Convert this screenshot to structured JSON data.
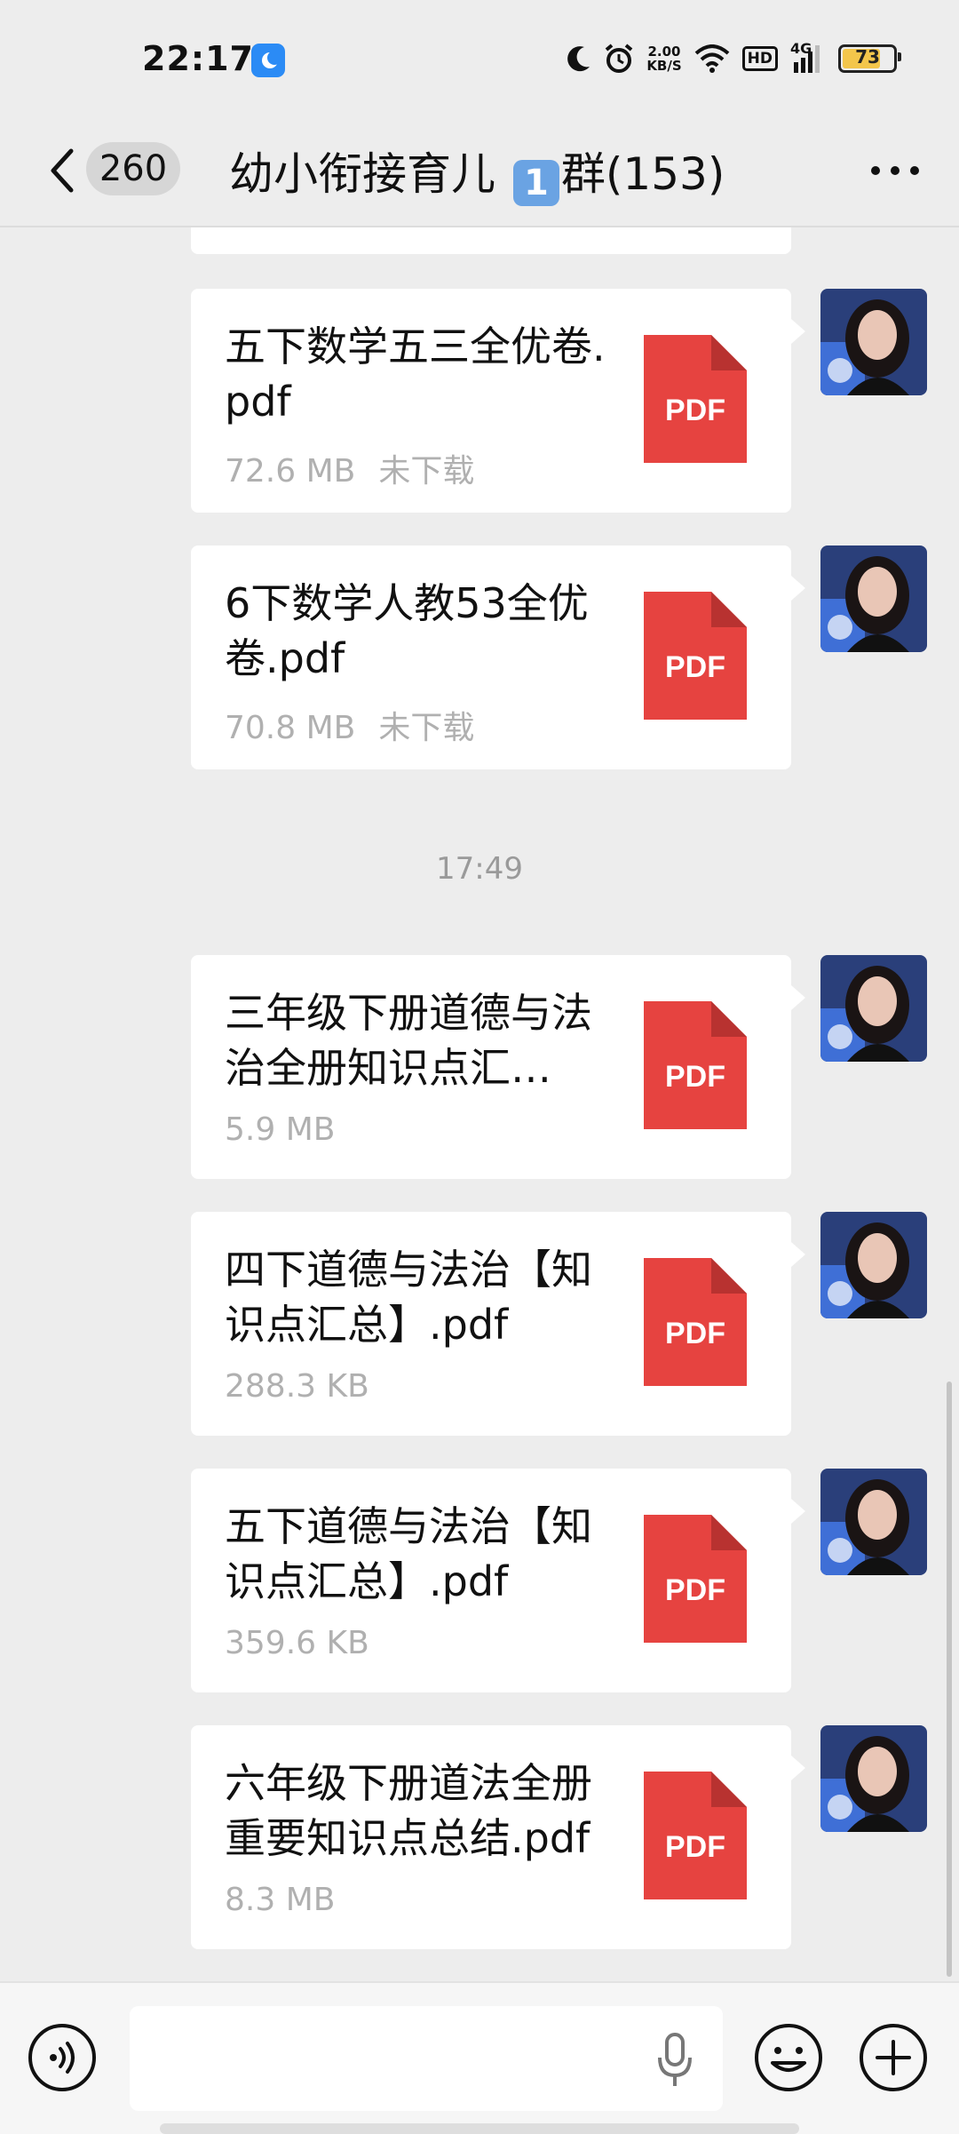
{
  "status_bar": {
    "time": "22:17",
    "net_speed_value": "2.00",
    "net_speed_unit": "KB/S",
    "hd_label": "HD",
    "network_label": "4G",
    "battery": "73"
  },
  "header": {
    "unread_count": "260",
    "title_before": "幼小衔接育儿 ",
    "title_emoji": "1",
    "title_after": "群(153)"
  },
  "messages": [
    {
      "file_name": "五下数学五三全优卷.pdf",
      "size": "72.6 MB",
      "status": "未下载",
      "icon_label": "PDF"
    },
    {
      "file_name": "6下数学人教53全优卷.pdf",
      "size": "70.8 MB",
      "status": "未下载",
      "icon_label": "PDF"
    },
    {
      "file_name": "三年级下册道德与法治全册知识点汇…",
      "size": "5.9 MB",
      "status": "",
      "icon_label": "PDF"
    },
    {
      "file_name": "四下道德与法治【知识点汇总】.pdf",
      "size": "288.3 KB",
      "status": "",
      "icon_label": "PDF"
    },
    {
      "file_name": "五下道德与法治【知识点汇总】.pdf",
      "size": "359.6 KB",
      "status": "",
      "icon_label": "PDF"
    },
    {
      "file_name": "六年级下册道法全册重要知识点总结.pdf",
      "size": "8.3 MB",
      "status": "",
      "icon_label": "PDF"
    }
  ],
  "time_divider": "17:49",
  "input": {
    "value": "",
    "placeholder": ""
  },
  "colors": {
    "background": "#ededed",
    "bubble": "#ffffff",
    "pdf_red": "#e64340",
    "meta_gray": "#b0b0b0",
    "battery_yellow": "#f3c64b"
  },
  "icons": [
    "back-icon",
    "more-icon",
    "pdf-icon",
    "voice-icon",
    "mic-icon",
    "emoji-icon",
    "plus-icon"
  ]
}
